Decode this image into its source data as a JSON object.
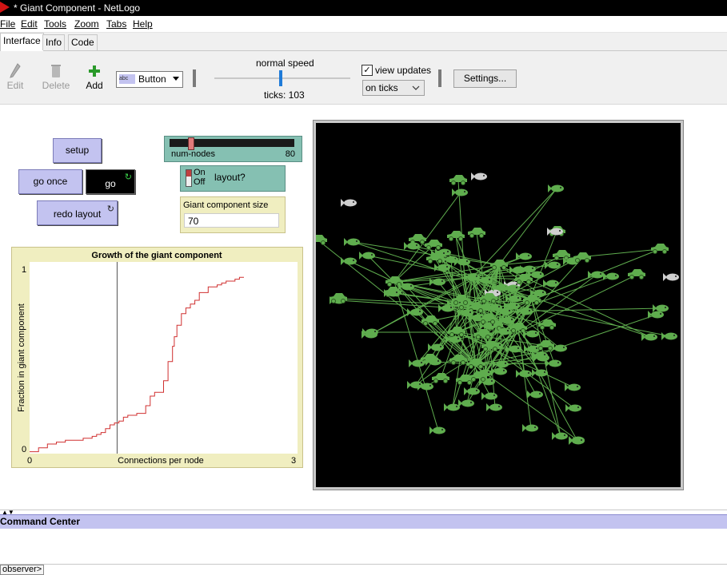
{
  "window": {
    "title": "* Giant Component - NetLogo"
  },
  "menu": [
    "File",
    "Edit",
    "Tools",
    "Zoom",
    "Tabs",
    "Help"
  ],
  "tabs": [
    "Interface",
    "Info",
    "Code"
  ],
  "toolbar": {
    "edit_label": "Edit",
    "delete_label": "Delete",
    "add_label": "Add",
    "widget_type": "Button",
    "speed_label": "normal speed",
    "speed_level": 0.5,
    "ticks_text": "ticks: 103",
    "view_updates_label": "view updates",
    "view_updates_checked": true,
    "update_mode": "on ticks",
    "settings_label": "Settings..."
  },
  "widgets": {
    "setup_label": "setup",
    "go_once_label": "go once",
    "go_label": "go",
    "redo_layout_label": "redo layout",
    "slider": {
      "name": "num-nodes",
      "value": "80",
      "min": 2,
      "max": 500,
      "level": 0.155
    },
    "switch": {
      "on_label": "On",
      "off_label": "Off",
      "name": "layout?"
    },
    "monitor": {
      "label": "Giant component size",
      "value": "70"
    },
    "plot": {
      "title": "Growth of the giant component",
      "ylabel": "Fraction in giant component",
      "xlabel": "Connections per node",
      "xmin_label": "0",
      "xmax_label": "3",
      "ymin_label": "0",
      "ymax_label": "1"
    }
  },
  "chart_data": {
    "type": "line",
    "title": "Growth of the giant component",
    "xlabel": "Connections per node",
    "ylabel": "Fraction in giant component",
    "xlim": [
      0,
      3
    ],
    "ylim": [
      0,
      1
    ],
    "series": [
      {
        "color": "#d03030",
        "x": [
          0,
          0.1,
          0.2,
          0.3,
          0.4,
          0.5,
          0.6,
          0.7,
          0.75,
          0.8,
          0.85,
          0.9,
          0.95,
          1.0,
          1.05,
          1.1,
          1.2,
          1.3,
          1.35,
          1.4,
          1.5,
          1.55,
          1.6,
          1.62,
          1.65,
          1.7,
          1.75,
          1.8,
          1.85,
          1.9,
          2.0,
          2.1,
          2.15,
          2.2,
          2.3,
          2.35,
          2.4
        ],
        "y": [
          0.01,
          0.03,
          0.05,
          0.06,
          0.07,
          0.07,
          0.08,
          0.09,
          0.1,
          0.11,
          0.13,
          0.15,
          0.16,
          0.17,
          0.19,
          0.2,
          0.21,
          0.25,
          0.3,
          0.32,
          0.38,
          0.48,
          0.56,
          0.61,
          0.67,
          0.73,
          0.76,
          0.78,
          0.8,
          0.84,
          0.87,
          0.88,
          0.89,
          0.9,
          0.91,
          0.92,
          0.92
        ]
      }
    ],
    "vline_x": 0.98
  },
  "network": {
    "colors": {
      "node": "#5fad4e",
      "isolated": "#cfcfcf",
      "link": "#5fad4e"
    }
  }
}
